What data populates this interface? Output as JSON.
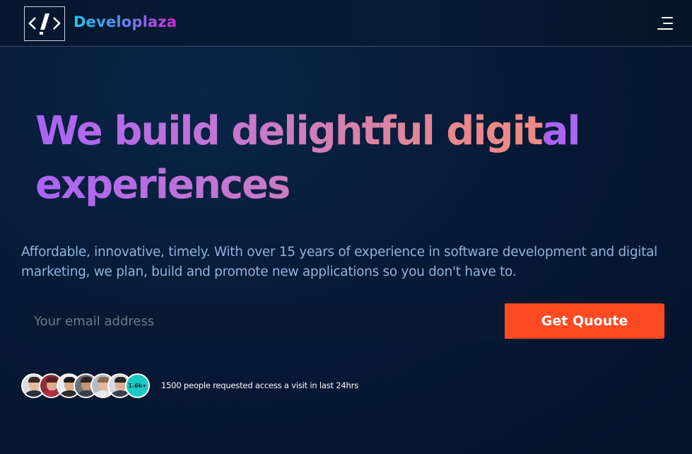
{
  "header": {
    "brand": "Developlaza",
    "logo_icon": "code-slash-icon",
    "menu_icon": "hamburger-menu-icon"
  },
  "hero": {
    "headline_line1": "We build delightful digital",
    "headline_line2": "experiences",
    "subtitle": "Affordable, innovative, timely. With over 15 years of experience in software development and digital marketing, we plan, build and promote new applications so you don't have to."
  },
  "signup": {
    "email_placeholder": "Your email address",
    "email_value": "",
    "button_label": "Get Quoute"
  },
  "social_proof": {
    "count_badge": "1.6k+",
    "text": "1500 people requested access a visit in last 24hrs"
  },
  "colors": {
    "accent_button": "#fd4a23",
    "badge": "#1bc9c4",
    "headline_gradient_start": "#a963f6",
    "headline_gradient_end": "#ef8a84",
    "brand_gradient_start": "#22c5ee",
    "brand_gradient_end": "#d52ad6",
    "subtitle_text": "#94b1dd"
  }
}
